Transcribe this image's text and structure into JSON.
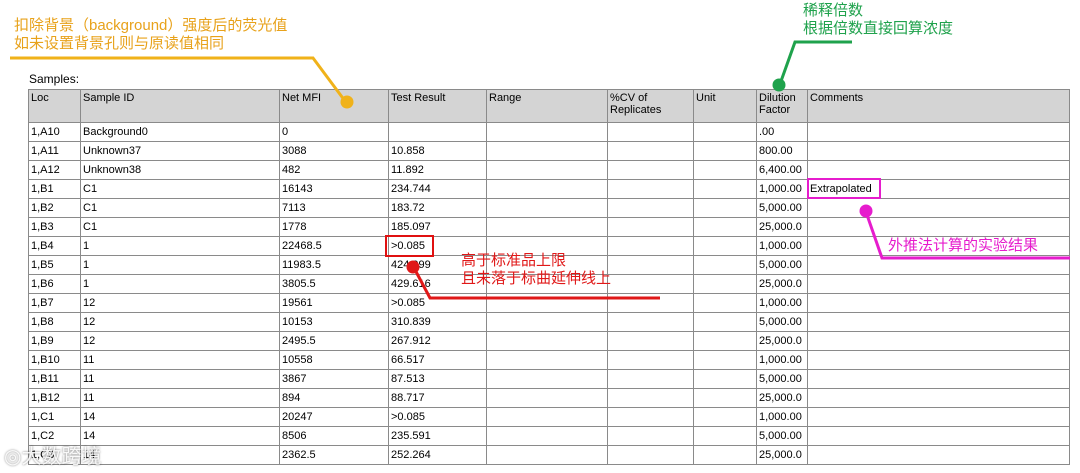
{
  "annotations": {
    "yellow_line1": "扣除背景（background）强度后的荧光值",
    "yellow_line2": "如未设置背景孔则与原读值相同",
    "green_line1": "稀释倍数",
    "green_line2": "根据倍数直接回算浓度",
    "magenta": "外推法计算的实验结果",
    "red_line1": "高于标准品上限",
    "red_line2": "且未落于标曲延伸线上"
  },
  "samples_label": "Samples:",
  "columns": [
    "Loc",
    "Sample ID",
    "Net MFI",
    "Test Result",
    "Range",
    "%CV of Replicates",
    "Unit",
    "Dilution Factor",
    "Comments"
  ],
  "rows": [
    [
      "1,A10",
      "Background0",
      "0",
      "",
      "",
      "",
      "",
      ".00",
      ""
    ],
    [
      "1,A11",
      "Unknown37",
      "3088",
      "10.858",
      "",
      "",
      "",
      "800.00",
      ""
    ],
    [
      "1,A12",
      "Unknown38",
      "482",
      "11.892",
      "",
      "",
      "",
      "6,400.00",
      ""
    ],
    [
      "1,B1",
      "C1",
      "16143",
      "234.744",
      "",
      "",
      "",
      "1,000.00",
      "Extrapolated"
    ],
    [
      "1,B2",
      "C1",
      "7113",
      "183.72",
      "",
      "",
      "",
      "5,000.00",
      ""
    ],
    [
      "1,B3",
      "C1",
      "1778",
      "185.097",
      "",
      "",
      "",
      "25,000.0",
      ""
    ],
    [
      "1,B4",
      "1",
      "22468.5",
      ">0.085",
      "",
      "",
      "",
      "1,000.00",
      ""
    ],
    [
      "1,B5",
      "1",
      "11983.5",
      "424.099",
      "",
      "",
      "",
      "5,000.00",
      ""
    ],
    [
      "1,B6",
      "1",
      "3805.5",
      "429.616",
      "",
      "",
      "",
      "25,000.0",
      ""
    ],
    [
      "1,B7",
      "12",
      "19561",
      ">0.085",
      "",
      "",
      "",
      "1,000.00",
      ""
    ],
    [
      "1,B8",
      "12",
      "10153",
      "310.839",
      "",
      "",
      "",
      "5,000.00",
      ""
    ],
    [
      "1,B9",
      "12",
      "2495.5",
      "267.912",
      "",
      "",
      "",
      "25,000.0",
      ""
    ],
    [
      "1,B10",
      "11",
      "10558",
      "66.517",
      "",
      "",
      "",
      "1,000.00",
      ""
    ],
    [
      "1,B11",
      "11",
      "3867",
      "87.513",
      "",
      "",
      "",
      "5,000.00",
      ""
    ],
    [
      "1,B12",
      "11",
      "894",
      "88.717",
      "",
      "",
      "",
      "25,000.0",
      ""
    ],
    [
      "1,C1",
      "14",
      "20247",
      ">0.085",
      "",
      "",
      "",
      "1,000.00",
      ""
    ],
    [
      "1,C2",
      "14",
      "8506",
      "235.591",
      "",
      "",
      "",
      "5,000.00",
      ""
    ],
    [
      "1,C3",
      "14",
      "2362.5",
      "252.264",
      "",
      "",
      "",
      "25,000.0",
      ""
    ]
  ],
  "watermark": "大数跨境",
  "colors": {
    "yellow": "#e8a21b",
    "green": "#1fa24c",
    "magenta": "#e61ccd",
    "red": "#e01818",
    "header_bg": "#d4d4d4"
  }
}
